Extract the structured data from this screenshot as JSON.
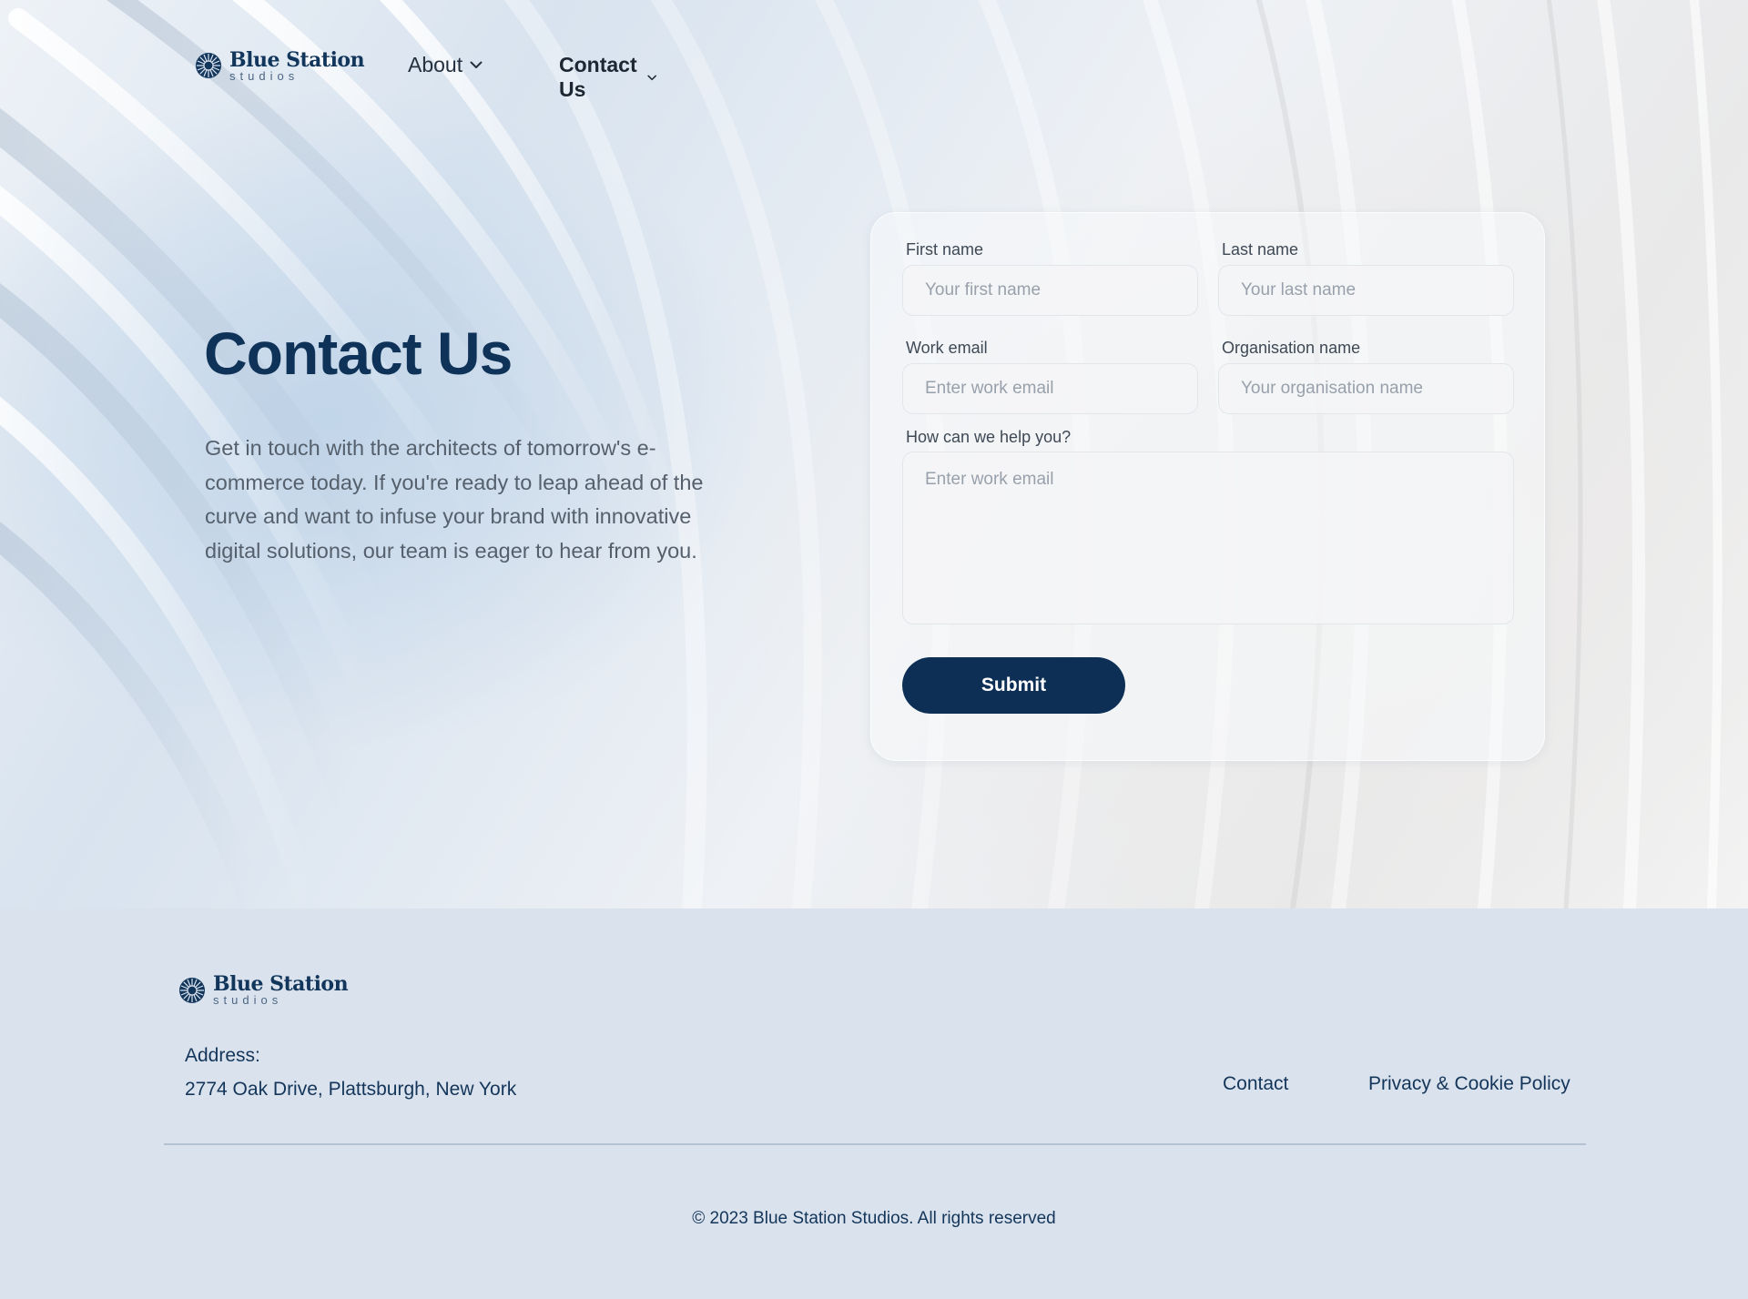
{
  "brand": {
    "name": "Blue Station",
    "tagline": "studios"
  },
  "nav": {
    "items": [
      {
        "label": "About"
      },
      {
        "label": "Contact Us"
      }
    ]
  },
  "hero": {
    "title": "Contact Us",
    "description": "Get in touch with the architects of tomorrow's e-commerce today. If you're ready to leap ahead of the curve and want to infuse your brand with innovative digital solutions, our team is eager to hear from you."
  },
  "form": {
    "first_name": {
      "label": "First name",
      "placeholder": "Your first name"
    },
    "last_name": {
      "label": "Last name",
      "placeholder": "Your last name"
    },
    "work_email": {
      "label": "Work email",
      "placeholder": "Enter work email"
    },
    "organisation": {
      "label": "Organisation name",
      "placeholder": "Your organisation name"
    },
    "message": {
      "label": "How can we help you?",
      "placeholder": "Enter work email"
    },
    "submit_label": "Submit"
  },
  "footer": {
    "address_label": "Address:",
    "address_value": "2774 Oak Drive, Plattsburgh, New York",
    "links": [
      {
        "label": "Contact"
      },
      {
        "label": "Privacy & Cookie Policy"
      }
    ],
    "copyright": "© 2023 Blue Station Studios. All rights reserved"
  },
  "colors": {
    "primary": "#0d2f55",
    "heading": "#0f3258",
    "footer_bg": "#dae3ed",
    "body_text": "#55606c"
  },
  "icons": [
    "flower-logo-icon",
    "chevron-down-icon"
  ]
}
